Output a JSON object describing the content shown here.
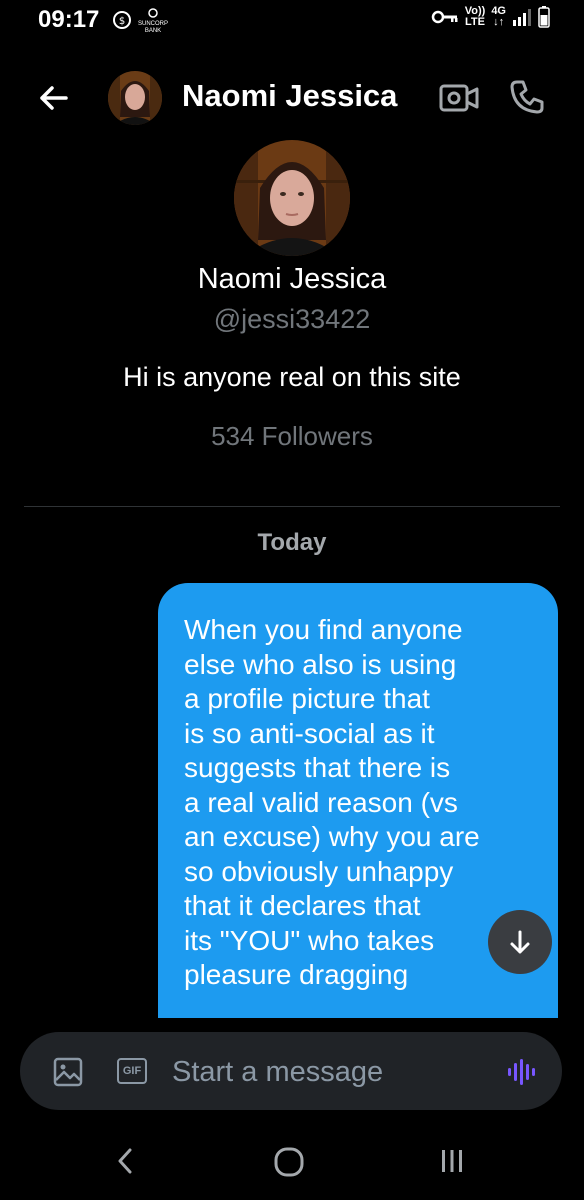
{
  "status_bar": {
    "time": "09:17",
    "bank_label_line1": "SUNCORP",
    "bank_label_line2": "BANK",
    "volte_line1": "Vo))",
    "volte_line2": "LTE",
    "network": "4G"
  },
  "header": {
    "name": "Naomi Jessica"
  },
  "profile": {
    "name": "Naomi Jessica",
    "handle": "@jessi33422",
    "bio": "Hi is anyone real on this site",
    "followers": "534 Followers"
  },
  "conversation": {
    "date_label": "Today",
    "message_text": "When you find anyone\nelse who also is using\na profile picture that\nis so anti-social as it\nsuggests that there is\na real valid reason (vs\nan excuse) why you are\nso obviously unhappy\nthat it declares that\nits \"YOU\" who takes\npleasure dragging",
    "bubble_color": "#1d9bf0"
  },
  "composer": {
    "placeholder": "Start a message",
    "gif_label": "GIF"
  },
  "icons": {
    "back": "arrow-left-icon",
    "video": "video-camera-icon",
    "call": "phone-icon",
    "image": "image-icon",
    "voice": "waveform-icon",
    "scroll_down": "arrow-down-icon"
  }
}
